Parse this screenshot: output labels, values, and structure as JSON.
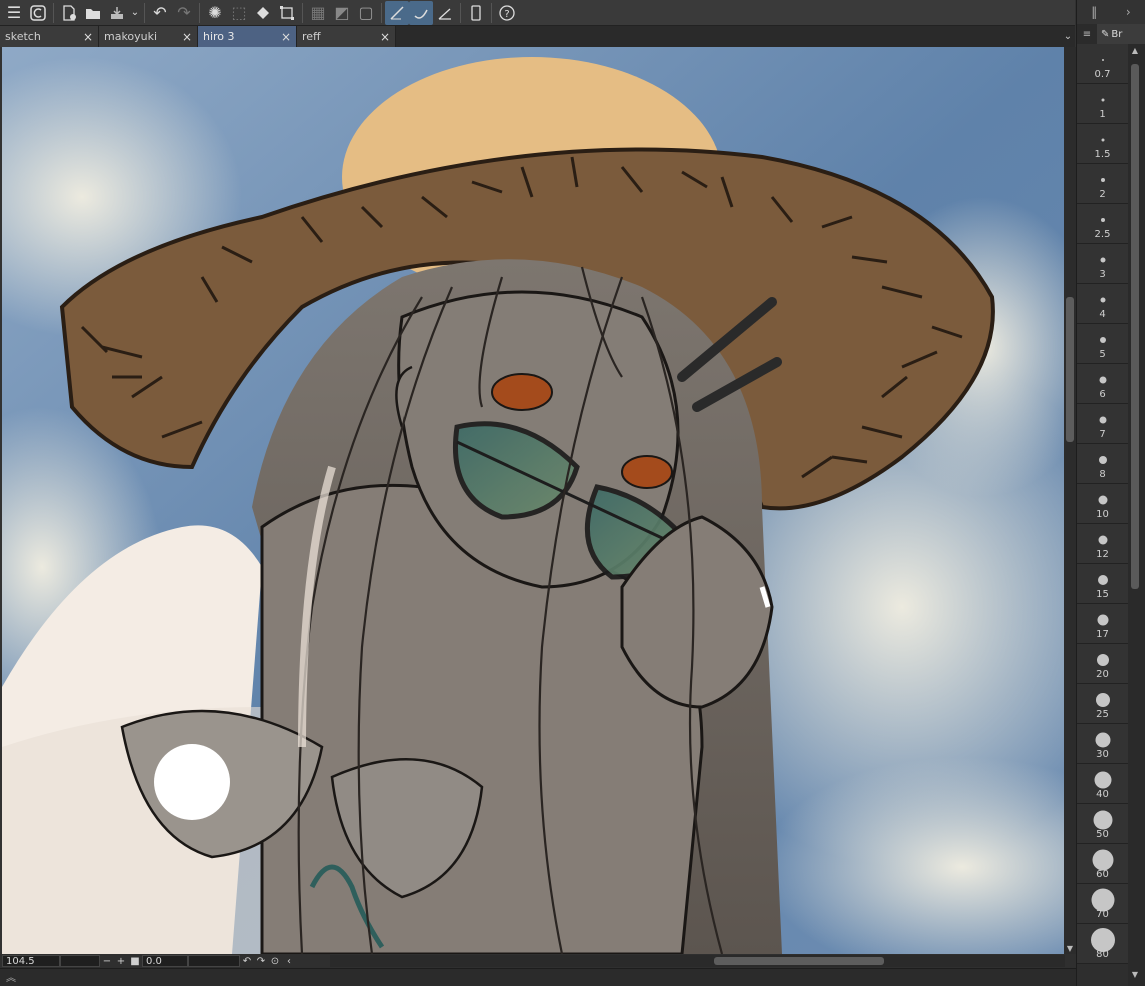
{
  "toolbar": {
    "icons": [
      "menu-icon",
      "clip-logo-icon",
      "new-file-icon",
      "open-folder-icon",
      "save-icon",
      "dropdown-icon",
      "undo-icon",
      "redo-icon",
      "loading-icon",
      "selection-icon",
      "fill-icon",
      "transform-icon",
      "grid-icon",
      "gradient-icon",
      "frame-icon",
      "ruler-icon",
      "curve-ruler-icon",
      "perspective-icon",
      "device-icon",
      "help-icon"
    ]
  },
  "tabs": [
    {
      "label": "sketch",
      "active": false
    },
    {
      "label": "makoyuki",
      "active": false
    },
    {
      "label": "hiro 3",
      "active": true
    },
    {
      "label": "reff",
      "active": false
    }
  ],
  "tab_close": "×",
  "status": {
    "zoom": "104.5",
    "angle": "0.0",
    "minus": "−",
    "plus": "+"
  },
  "right_panel": {
    "tab_label": "Br",
    "brush_sizes": [
      "0.7",
      "1",
      "1.5",
      "2",
      "2.5",
      "3",
      "4",
      "5",
      "6",
      "7",
      "8",
      "10",
      "12",
      "15",
      "17",
      "20",
      "25",
      "30",
      "40",
      "50",
      "60",
      "70",
      "80"
    ]
  },
  "colors": {
    "accent": "#4d6283",
    "sky": "#6f8fb3",
    "hat": "#7a5a3a",
    "skin": "#8a837b"
  }
}
